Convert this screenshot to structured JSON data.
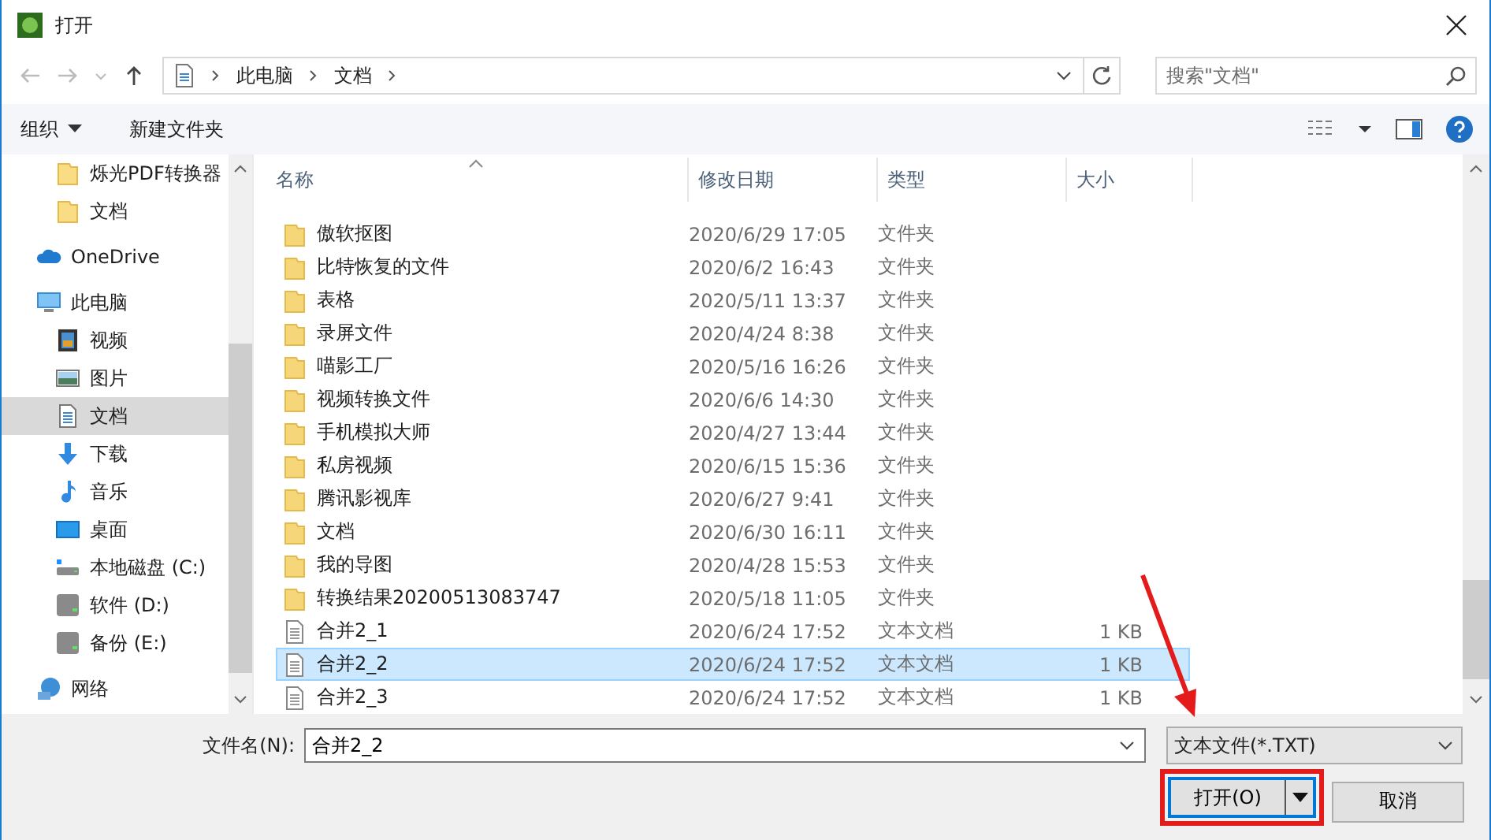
{
  "window": {
    "title": "打开"
  },
  "address": {
    "crumbs": [
      "此电脑",
      "文档"
    ]
  },
  "search": {
    "placeholder": "搜索\"文档\""
  },
  "toolbar": {
    "organize": "组织",
    "new_folder": "新建文件夹"
  },
  "quick_access": [
    {
      "kind": "folder",
      "label": "烁光PDF转换器",
      "selected": false
    },
    {
      "kind": "folder",
      "label": "文档",
      "selected": false
    }
  ],
  "sidebar": [
    {
      "kind": "cloud",
      "label": "OneDrive",
      "selected": false
    },
    {
      "kind": "pc",
      "label": "此电脑",
      "selected": false,
      "children": [
        {
          "kind": "video",
          "label": "视频",
          "selected": false
        },
        {
          "kind": "picture",
          "label": "图片",
          "selected": false
        },
        {
          "kind": "document",
          "label": "文档",
          "selected": true
        },
        {
          "kind": "download",
          "label": "下载",
          "selected": false
        },
        {
          "kind": "music",
          "label": "音乐",
          "selected": false
        },
        {
          "kind": "desktop",
          "label": "桌面",
          "selected": false
        },
        {
          "kind": "system-drive",
          "label": "本地磁盘 (C:)",
          "selected": false
        },
        {
          "kind": "drive",
          "label": "软件 (D:)",
          "selected": false
        },
        {
          "kind": "drive",
          "label": "备份 (E:)",
          "selected": false
        }
      ]
    },
    {
      "kind": "network",
      "label": "网络",
      "selected": false
    }
  ],
  "table": {
    "columns": [
      "名称",
      "修改日期",
      "类型",
      "大小"
    ],
    "rows": [
      {
        "kind": "folder",
        "name": "傲软抠图",
        "date": "2020/6/29 17:05",
        "type": "文件夹",
        "selected": false
      },
      {
        "kind": "folder",
        "name": "比特恢复的文件",
        "date": "2020/6/2 16:43",
        "type": "文件夹",
        "selected": false
      },
      {
        "kind": "folder",
        "name": "表格",
        "date": "2020/5/11 13:37",
        "type": "文件夹",
        "selected": false
      },
      {
        "kind": "folder",
        "name": "录屏文件",
        "date": "2020/4/24 8:38",
        "type": "文件夹",
        "selected": false
      },
      {
        "kind": "folder",
        "name": "喵影工厂",
        "date": "2020/5/16 16:26",
        "type": "文件夹",
        "selected": false
      },
      {
        "kind": "folder",
        "name": "视频转换文件",
        "date": "2020/6/6 14:30",
        "type": "文件夹",
        "selected": false
      },
      {
        "kind": "folder",
        "name": "手机模拟大师",
        "date": "2020/4/27 13:44",
        "type": "文件夹",
        "selected": false
      },
      {
        "kind": "folder",
        "name": "私房视频",
        "date": "2020/6/15 15:36",
        "type": "文件夹",
        "selected": false
      },
      {
        "kind": "folder",
        "name": "腾讯影视库",
        "date": "2020/6/27 9:41",
        "type": "文件夹",
        "selected": false
      },
      {
        "kind": "folder",
        "name": "文档",
        "date": "2020/6/30 16:11",
        "type": "文件夹",
        "selected": false
      },
      {
        "kind": "folder",
        "name": "我的导图",
        "date": "2020/4/28 15:53",
        "type": "文件夹",
        "selected": false
      },
      {
        "kind": "folder",
        "name": "转换结果20200513083747",
        "date": "2020/5/18 11:05",
        "type": "文件夹",
        "selected": false
      },
      {
        "kind": "text",
        "name": "合并2_1",
        "date": "2020/6/24 17:52",
        "type": "文本文档",
        "size": "1 KB",
        "selected": false
      },
      {
        "kind": "text",
        "name": "合并2_2",
        "date": "2020/6/24 17:52",
        "type": "文本文档",
        "size": "1 KB",
        "selected": true
      },
      {
        "kind": "text",
        "name": "合并2_3",
        "date": "2020/6/24 17:52",
        "type": "文本文档",
        "size": "1 KB",
        "selected": false
      }
    ]
  },
  "footer": {
    "filename_label": "文件名(N):",
    "filename": "合并2_2",
    "filter": "文本文件(*.TXT)",
    "open_button": "打开(O)",
    "cancel_button": "取消"
  },
  "annotations": {
    "arrow": true,
    "open_button_frame": true
  }
}
